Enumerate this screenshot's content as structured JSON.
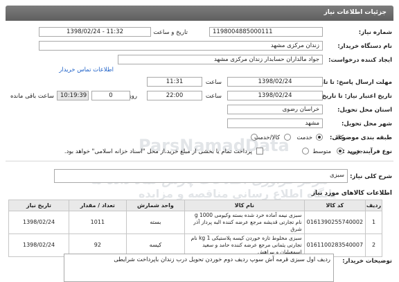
{
  "header": {
    "title": "جزئیات اطلاعات نیاز"
  },
  "form": {
    "need_number_label": "شماره نیاز:",
    "need_number": "1198004885000111",
    "announce_label": "تاریخ و ساعت اعلان عمومی:",
    "announce_value": "1398/02/24 - 11:32",
    "buyer_label": "نام دستگاه خریدار:",
    "buyer_value": "زندان مرکزی مشهد",
    "creator_label": "ایجاد کننده درخواست:",
    "creator_value": "جواد مالداران حسابدار زندان مرکزی مشهد",
    "contact_link": "اطلاعات تماس خریدار",
    "reply_deadline_label": "مهلت ارسال پاسخ: تا تاریخ:",
    "reply_date": "1398/02/24",
    "time_label": "ساعت",
    "reply_time": "11:31",
    "validity_label": "تاریخ اعتبار نیاز: تا تاریخ:",
    "validity_date": "1398/02/24",
    "validity_time": "22:00",
    "days_label": "روز و",
    "days_value": "0",
    "remaining_time": "10:19:39",
    "remaining_label": "ساعت باقی مانده",
    "province_label": "استان محل تحویل:",
    "province_value": "خراسان رضوی",
    "city_label": "شهر محل تحویل:",
    "city_value": "مشهد",
    "category_label": "طبقه بندی موضوعی:",
    "category_options": [
      "کالا",
      "خدمت",
      "کالا/خدمت"
    ],
    "purchase_type_label": "نوع فرآیند خرید :",
    "purchase_options": [
      "جزیی",
      "متوسط"
    ],
    "payment_note": "پرداخت تمام یا بخشی از مبلغ خرید،از محل \"اسناد خزانه اسلامی\" خواهد بود."
  },
  "general_description": {
    "label": "شرح کلی نیاز:",
    "value": "سبزی"
  },
  "items_section": {
    "title": "اطلاعات کالاهای مورد نیاز",
    "columns": [
      "ردیف",
      "کد کالا",
      "نام کالا",
      "واحد شمارش",
      "تعداد / مقدار",
      "تاریخ نیاز"
    ],
    "rows": [
      {
        "row": "1",
        "code": "0161390255740002",
        "name": "سبزی نیمه آماده خرد شده بسته وکیومی 1000 g نام تجارتی قدیشه مرجع عرضه کننده البه پرداز آذر شرق",
        "unit": "بسته",
        "qty": "1011",
        "date": "1398/02/24"
      },
      {
        "row": "2",
        "code": "0161100283540007",
        "name": "سبزی مخلوط تازه خوردن کیسه پلاستیکی 1 kg نام تجارتی یثمانی مرجع عرضه کننده حامد و سعید اسمعیلیان و پیراهش",
        "unit": "کیسه",
        "qty": "92",
        "date": "1398/02/24"
      }
    ]
  },
  "buyer_notes": {
    "label": "توضیحات خریدار:",
    "value": "ردیف اول سبزی قرمه آش سوپ ردیف دوم خوردن تحویل درب زندان باپرداخت شرایطی"
  },
  "watermark": {
    "line1": "مرکز فراوری اطلاعات پارس نماد داده ها",
    "line2": "ParsNamadData",
    "line3": "پایگاه اطلاع رسانی مناقصه و مزایده"
  }
}
